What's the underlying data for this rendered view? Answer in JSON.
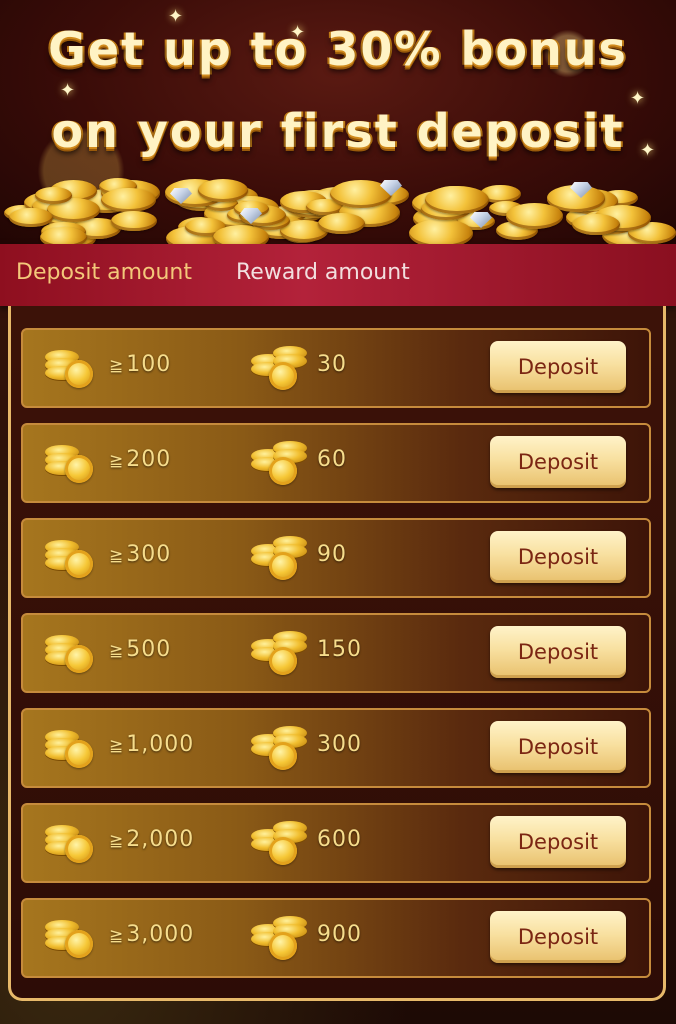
{
  "banner": {
    "line1": "Get up to 30% bonus",
    "line2": "on your first deposit"
  },
  "header": {
    "deposit_label": "Deposit amount",
    "reward_label": "Reward amount"
  },
  "rows": [
    {
      "min_prefix": "≧",
      "deposit": "100",
      "reward": "30",
      "button": "Deposit"
    },
    {
      "min_prefix": "≧",
      "deposit": "200",
      "reward": "60",
      "button": "Deposit"
    },
    {
      "min_prefix": "≧",
      "deposit": "300",
      "reward": "90",
      "button": "Deposit"
    },
    {
      "min_prefix": "≧",
      "deposit": "500",
      "reward": "150",
      "button": "Deposit"
    },
    {
      "min_prefix": "≧",
      "deposit": "1,000",
      "reward": "300",
      "button": "Deposit"
    },
    {
      "min_prefix": "≧",
      "deposit": "2,000",
      "reward": "600",
      "button": "Deposit"
    },
    {
      "min_prefix": "≧",
      "deposit": "3,000",
      "reward": "900",
      "button": "Deposit"
    }
  ],
  "colors": {
    "header_strip": "#b3223a",
    "accent_gold": "#f6dd8c",
    "button_text": "#7b2613"
  },
  "icons": {
    "deposit_coin": "coin-stack-icon",
    "reward_coin": "coin-stack-icon"
  }
}
